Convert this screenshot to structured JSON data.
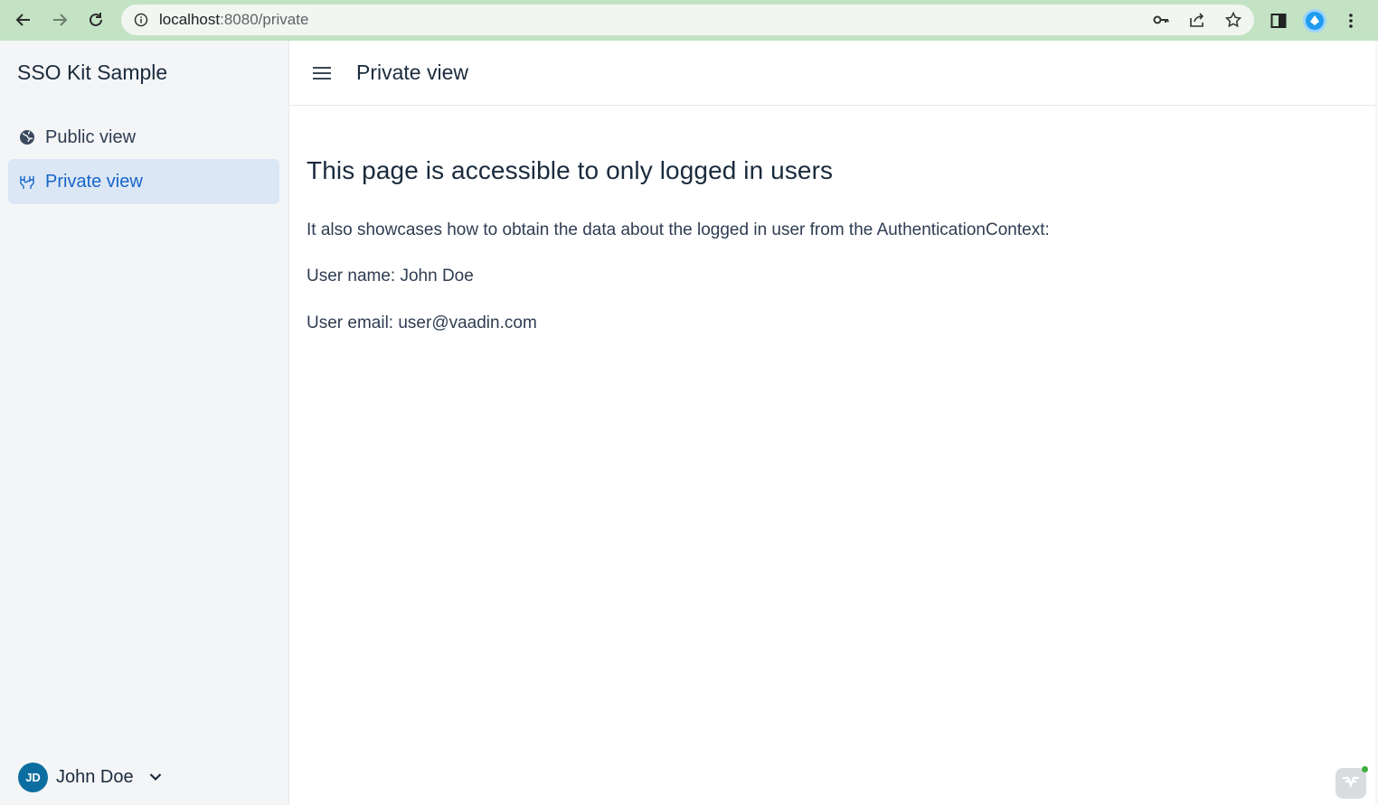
{
  "browser": {
    "url_host": "localhost",
    "url_path": ":8080/private"
  },
  "app": {
    "title": "SSO Kit Sample",
    "nav": [
      {
        "label": "Public view",
        "icon": "globe-icon"
      },
      {
        "label": "Private view",
        "icon": "hands-icon",
        "active": true
      }
    ],
    "user": {
      "initials": "JD",
      "name": "John Doe"
    }
  },
  "header": {
    "title": "Private view"
  },
  "main": {
    "heading": "This page is accessible to only logged in users",
    "description": "It also showcases how to obtain the data about the logged in user from the AuthenticationContext:",
    "user_name_line": "User name: John Doe",
    "user_email_line": "User email: user@vaadin.com"
  },
  "colors": {
    "chrome_bg": "#c3e3c4",
    "drawer_bg": "#f4f5f7",
    "active_nav_bg": "#dce7f6",
    "accent": "#1565c8",
    "avatar_bg": "#0c6ea0"
  }
}
